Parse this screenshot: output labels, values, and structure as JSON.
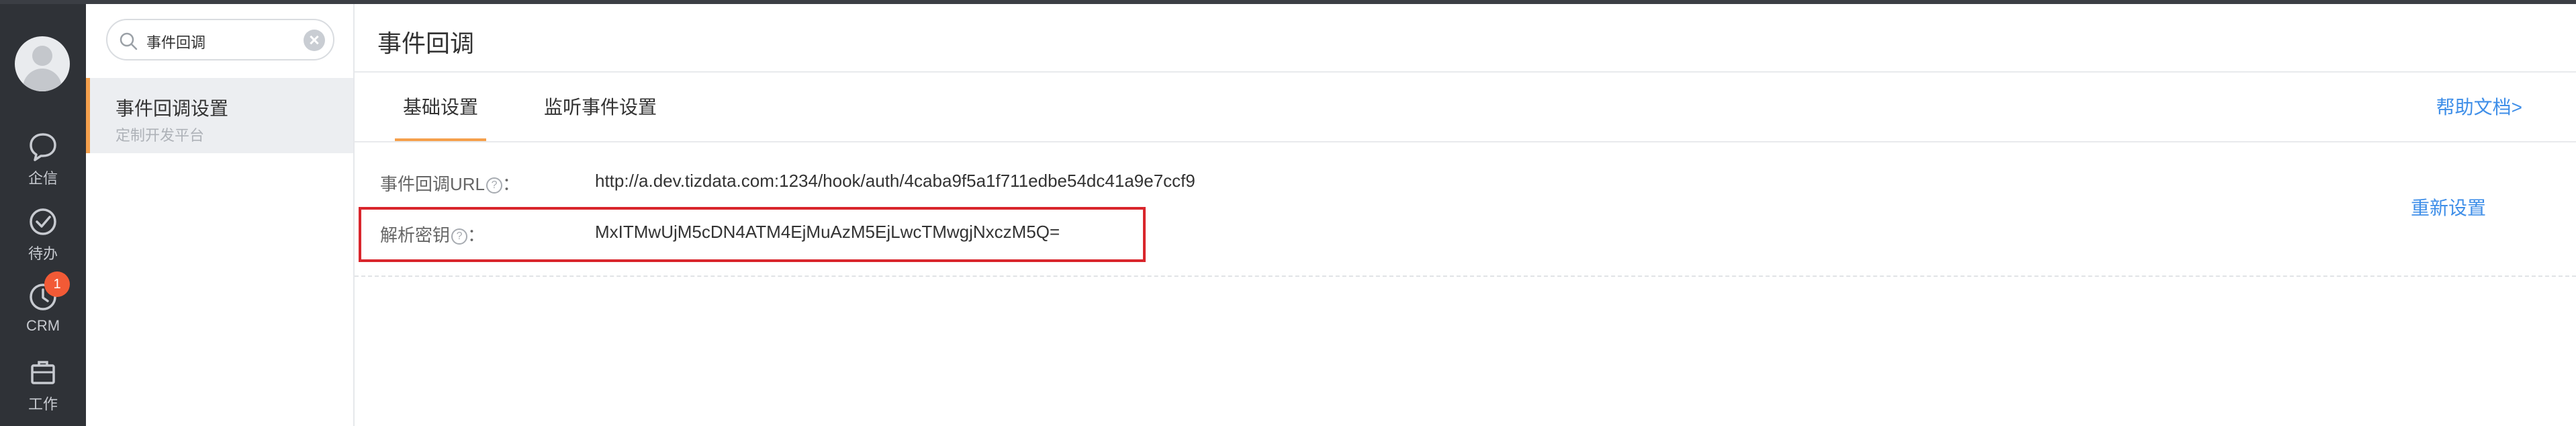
{
  "nav": {
    "items": [
      {
        "label": "企信",
        "icon": "chat-bubble-icon"
      },
      {
        "label": "待办",
        "icon": "check-circle-icon"
      },
      {
        "label": "CRM",
        "icon": "clock-icon",
        "badge": "1"
      },
      {
        "label": "工作",
        "icon": "briefcase-icon"
      }
    ]
  },
  "subnav": {
    "search_value": "事件回调",
    "active_item": {
      "title": "事件回调设置",
      "desc": "定制开发平台"
    }
  },
  "main": {
    "title": "事件回调",
    "tabs": [
      {
        "label": "基础设置",
        "active": true
      },
      {
        "label": "监听事件设置",
        "active": false
      }
    ],
    "help_link": "帮助文档>",
    "rows": [
      {
        "label": "事件回调URL",
        "colon": "：",
        "value": "http://a.dev.tizdata.com:1234/hook/auth/4caba9f5a1f711edbe54dc41a9e7ccf9"
      },
      {
        "label": "解析密钥",
        "colon": "：",
        "value": "MxITMwUjM5cDN4ATM4EjMuAzM5EjLwcTMwgjNxczM5Q="
      }
    ],
    "reset_link": "重新设置"
  },
  "colors": {
    "accent": "#f5a04c",
    "link": "#3e8ee8",
    "badge": "#f25a36",
    "highlight_box": "#d9262c",
    "rail_bg": "#2f3237"
  }
}
